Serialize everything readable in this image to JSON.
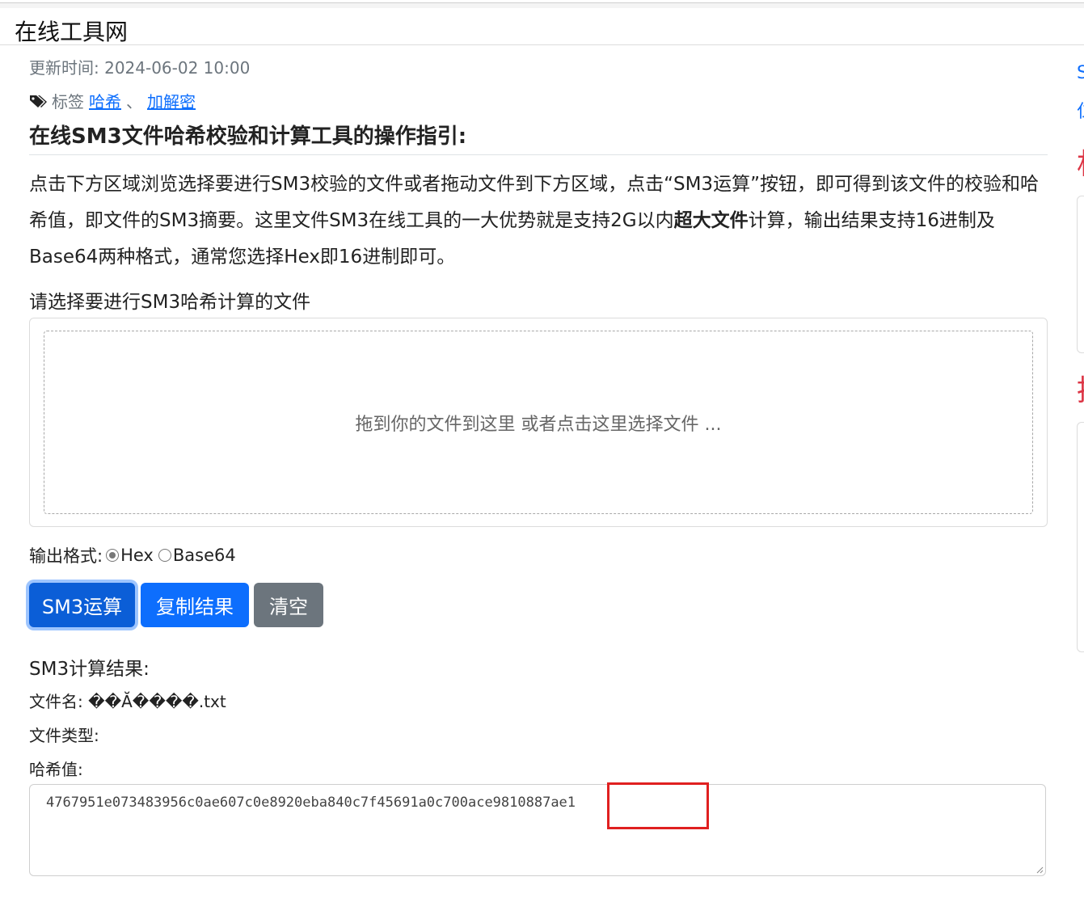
{
  "header": {
    "site_title": "在线工具网"
  },
  "article": {
    "update_time": "更新时间: 2024-06-02 10:00",
    "tags_label": "标签",
    "tags": [
      "哈希",
      "加解密"
    ],
    "tag_separator": "、",
    "section_title": "在线SM3文件哈希校验和计算工具的操作指引:",
    "desc_part1": "点击下方区域浏览选择要进行SM3校验的文件或者拖动文件到下方区域，点击“SM3运算”按钮，即可得到该文件的校验和哈希值，即文件的SM3摘要。这里文件SM3在线工具的一大优势就是支持2G以内",
    "desc_bold": "超大文件",
    "desc_part2": "计算，输出结果支持16进制及Base64两种格式，通常您选择Hex即16进制即可。"
  },
  "upload": {
    "label": "请选择要进行SM3哈希计算的文件",
    "dropzone_text": "拖到你的文件到这里 或者点击这里选择文件 ..."
  },
  "format": {
    "label": "输出格式:",
    "options": [
      {
        "label": "Hex",
        "selected": true
      },
      {
        "label": "Base64",
        "selected": false
      }
    ]
  },
  "buttons": {
    "compute": "SM3运算",
    "copy": "复制结果",
    "clear": "清空"
  },
  "result": {
    "title": "SM3计算结果:",
    "filename_label": "文件名:",
    "filename_value": "��Ă����.txt",
    "filetype_label": "文件类型:",
    "filetype_value": "",
    "hash_label": "哈希值:",
    "hash_value": "4767951e073483956c0ae607c0e8920eba840c7f45691a0c700ace9810887ae1"
  },
  "sidebar": {
    "blue_text_1": "S",
    "blue_text_2": "仁",
    "red_text_1": "相",
    "red_text_2": "推"
  },
  "colors": {
    "primary": "#0d6efd",
    "secondary": "#6c757d",
    "highlight": "#e02020",
    "link": "#0d6efd"
  }
}
